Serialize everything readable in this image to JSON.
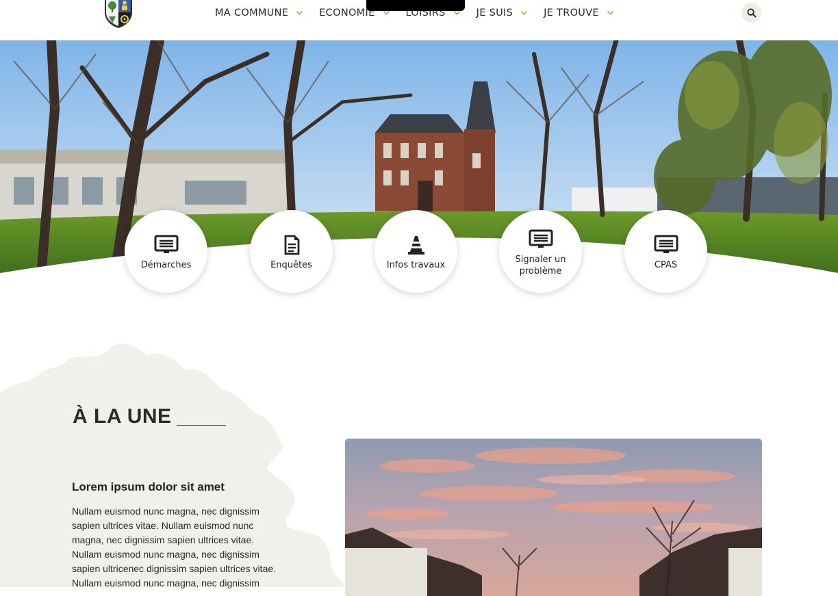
{
  "header": {
    "nav": [
      {
        "label": "MA COMMUNE"
      },
      {
        "label": "ECONOMIE"
      },
      {
        "label": "LOISIRS"
      },
      {
        "label": "JE SUIS"
      },
      {
        "label": "JE TROUVE"
      }
    ],
    "icons": {
      "search": "search-icon",
      "chevron": "chevron-down-icon",
      "logo": "coat-of-arms-icon"
    }
  },
  "quick_links": [
    {
      "label": "Démarches",
      "icon": "screen-list-icon"
    },
    {
      "label": "Enquêtes",
      "icon": "document-icon"
    },
    {
      "label": "Infos travaux",
      "icon": "traffic-cone-icon"
    },
    {
      "label": "Signaler un problème",
      "icon": "screen-list-icon"
    },
    {
      "label": "CPAS",
      "icon": "screen-list-icon"
    }
  ],
  "une": {
    "title": "À LA UNE",
    "article": {
      "title": "Lorem ipsum dolor sit amet",
      "body": "Nullam euismod nunc magna, nec dignissim sapien ultrices vitae. Nullam euismod nunc magna, nec dignissim sapien ultrices vitae. Nullam euismod nunc magna, nec dignissim sapien ultricenec dignissim sapien ultrices vitae. Nullam euismod nunc magna, nec dignissim"
    }
  },
  "colors": {
    "accent": "#7cb342",
    "blob": "#eef2ea",
    "search_bg": "#e9efe3",
    "text": "#2a2a2a"
  }
}
